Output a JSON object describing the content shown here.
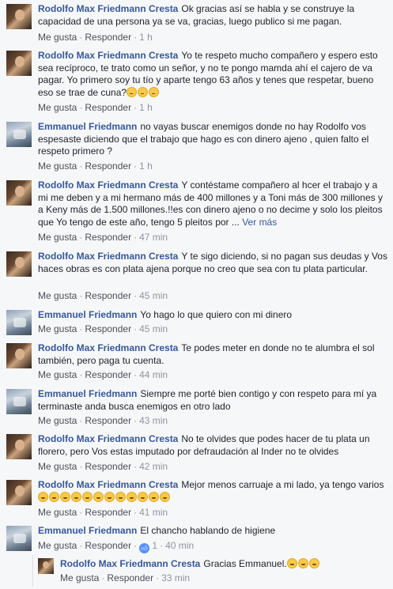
{
  "actions": {
    "like": "Me gusta",
    "reply": "Responder",
    "separator": "·"
  },
  "comments": [
    {
      "author": "Rodolfo Max Friedmann Cresta",
      "text": "Ok gracias así se habla y se construye la capacidad de una persona ya se va, gracias, luego publico si me pagan.",
      "time": "1 h"
    },
    {
      "author": "Rodolfo Max Friedmann Cresta",
      "text": "Yo te respeto mucho compañero y espero esto sea recíproco, te trato como un señor, y no te pongo mamda ahí el cajero de va pagar. Yo primero soy tu tío y aparte tengo 63 años y tenes que respetar, bueno eso se trae de cuna?",
      "time": "1 h"
    },
    {
      "author": "Emmanuel Friedmann",
      "text": "no vayas buscar enemigos donde no hay Rodolfo vos espesaste diciendo que el trabajo que hago es con dinero ajeno , quien falto el respeto primero ?",
      "time": "1 h"
    },
    {
      "author": "Rodolfo Max Friedmann Cresta",
      "text": "Y contéstame compañero al hcer el trabajo y a mi me deben y a mi hermano más de 400 millones y a Toni más de 300 millones y a Keny más de 1.500 millones.!!es con dinero ajeno o no decime y solo los pleitos que Yo tengo de este año, tengo 5 pleitos por ...",
      "more": "Ver más",
      "time": "47 min"
    },
    {
      "author": "Rodolfo Max Friedmann Cresta",
      "text": "Y te sigo diciendo, si no pagan sus deudas y Vos haces obras es con plata ajena porque no creo que sea con tu plata particular.",
      "time": "45 min"
    },
    {
      "author": "Emmanuel Friedmann",
      "text": "Yo hago lo que quiero con mi dinero",
      "time": "45 min"
    },
    {
      "author": "Rodolfo Max Friedmann Cresta",
      "text": "Te podes meter en donde no te alumbra el sol también, pero paga tu cuenta.",
      "time": "44 min"
    },
    {
      "author": "Emmanuel Friedmann",
      "text": "Siempre me porté bien contigo y con respeto para mí ya terminaste anda busca enemigos en otro lado",
      "time": "43 min"
    },
    {
      "author": "Rodolfo Max Friedmann Cresta",
      "text": "No te olvides que podes hacer de tu plata un florero, pero Vos estas imputado por defraudación al Inder no te olvides",
      "time": "42 min"
    },
    {
      "author": "Rodolfo Max Friedmann Cresta",
      "text": "Mejor menos carruaje a mi lado, ya tengo varios",
      "time": "41 min"
    },
    {
      "author": "Emmanuel Friedmann",
      "text": "El chancho hablando de higiene",
      "likes": "1",
      "time": "40 min"
    },
    {
      "author": "Rodolfo Max Friedmann Cresta",
      "text": "Gracias Emmanuel.",
      "time": "33 min"
    }
  ],
  "emoji_icon": "rolling-laughing-emoji",
  "colors": {
    "author": "#365899",
    "meta": "#90949c",
    "background": "#f6f7f9",
    "like_badge": "#5890ff"
  }
}
